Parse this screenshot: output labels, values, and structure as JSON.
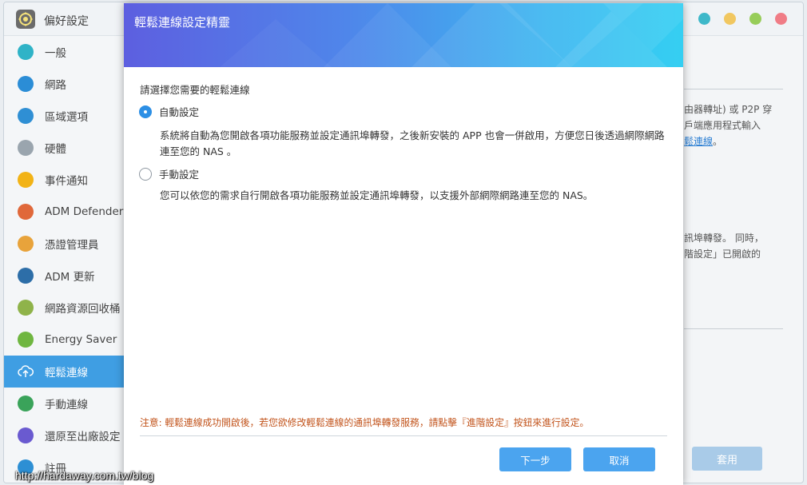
{
  "app": {
    "title": "偏好設定"
  },
  "window_dots": [
    "#3eb8c9",
    "#f1c760",
    "#97cd59",
    "#f07c86"
  ],
  "sidebar": {
    "items": [
      {
        "label": "一般",
        "icon": "general-icon",
        "color": "#2fb3c7"
      },
      {
        "label": "網路",
        "icon": "globe-icon",
        "color": "#2b8dd6"
      },
      {
        "label": "區域選項",
        "icon": "region-icon",
        "color": "#2f8fd4"
      },
      {
        "label": "硬體",
        "icon": "hardware-icon",
        "color": "#9aa5ae"
      },
      {
        "label": "事件通知",
        "icon": "alert-icon",
        "color": "#f2b316"
      },
      {
        "label": "ADM Defender",
        "icon": "firewall-icon",
        "color": "#e0683a"
      },
      {
        "label": "憑證管理員",
        "icon": "certificate-icon",
        "color": "#e8a33b"
      },
      {
        "label": "ADM 更新",
        "icon": "update-icon",
        "color": "#2d6ea8"
      },
      {
        "label": "網路資源回收桶",
        "icon": "recycle-bin-icon",
        "color": "#8fb34a"
      },
      {
        "label": "Energy Saver",
        "icon": "energy-icon",
        "color": "#6fb640"
      },
      {
        "label": "輕鬆連線",
        "icon": "cloud-upload-icon",
        "color": "#ffffff",
        "active": true
      },
      {
        "label": "手動連線",
        "icon": "manual-connect-icon",
        "color": "#3aa35a"
      },
      {
        "label": "還原至出廠設定",
        "icon": "restore-icon",
        "color": "#6a5ad0"
      },
      {
        "label": "註冊",
        "icon": "register-icon",
        "color": "#2d8fd4"
      }
    ]
  },
  "background": {
    "line1": "由器轉址) 或 P2P 穿",
    "line2": "戶端應用程式輸入",
    "line3_link": "鬆連線",
    "line3_suffix": "。",
    "line4": "訊埠轉發。 同時，",
    "line5": "階設定」已開啟的",
    "apply_label": "套用"
  },
  "dialog": {
    "title": "輕鬆連線設定精靈",
    "prompt": "請選擇您需要的輕鬆連線",
    "option_auto": {
      "label": "自動設定",
      "checked": true,
      "description": "系統將自動為您開啟各項功能服務並設定通訊埠轉發，之後新安裝的 APP 也會一併啟用，方便您日後透過網際網路連至您的 NAS 。"
    },
    "option_manual": {
      "label": "手動設定",
      "checked": false,
      "description": "您可以依您的需求自行開啟各項功能服務並設定通訊埠轉發，以支援外部網際網路連至您的 NAS。"
    },
    "note": "注意: 輕鬆連線成功開啟後，若您欲修改輕鬆連線的通訊埠轉發服務，請點擊『進階設定』按鈕來進行設定。",
    "next_label": "下一步",
    "cancel_label": "取消"
  },
  "watermark": "http://hardaway.com.tw/blog"
}
